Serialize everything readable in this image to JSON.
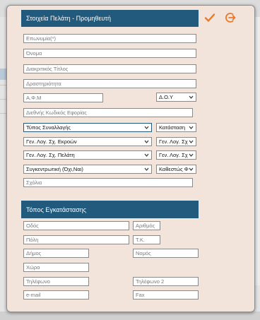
{
  "customer": {
    "title": "Στοιχεία Πελάτη - Προμηθευτή",
    "fields": {
      "company": "Επωνυμία(*)",
      "name": "Όνομα",
      "brand": "Διακριτικός Τίτλος",
      "activity": "Δραστηριότητα",
      "afm": "Α.Φ.Μ",
      "doy": "Δ.Ο.Υ",
      "intl_tax": "Διεθνής Κωδικός Εφορίας",
      "transaction_type": "Τύπος Συναλλαγής",
      "status": "Κατάσταση",
      "gl_expense": "Γεν. Λογ. Σχ. Εκροών",
      "gl_expense_small": "Γεν. Λογ. Σχ",
      "gl_customer": "Γεν. Λογ. Σχ. Πελάτη",
      "gl_customer_small": "Γεν. Λογ. Σχ",
      "summary": "Συγκεντρωτική (Όχι,Ναι)",
      "vat_status": "Καθεστώς Φ",
      "comments": "Σχόλια"
    }
  },
  "location": {
    "title": "Τόπος Εγκατάστασης",
    "fields": {
      "street": "Οδός",
      "number": "Αριθμός",
      "city": "Πόλη",
      "zip": "Τ.Κ.",
      "municipality": "Δήμος",
      "prefecture": "Νομός",
      "country": "Χώρα",
      "phone": "Τηλέφωνο",
      "phone2": "Τηλέφωνο 2",
      "email": "e-mail",
      "fax": "Fax"
    }
  },
  "colors": {
    "header": "#215a7d",
    "check": "#e87a2c",
    "panel": "#f2e4da"
  },
  "icons": {
    "save": "check-icon",
    "exit": "exit-icon"
  }
}
